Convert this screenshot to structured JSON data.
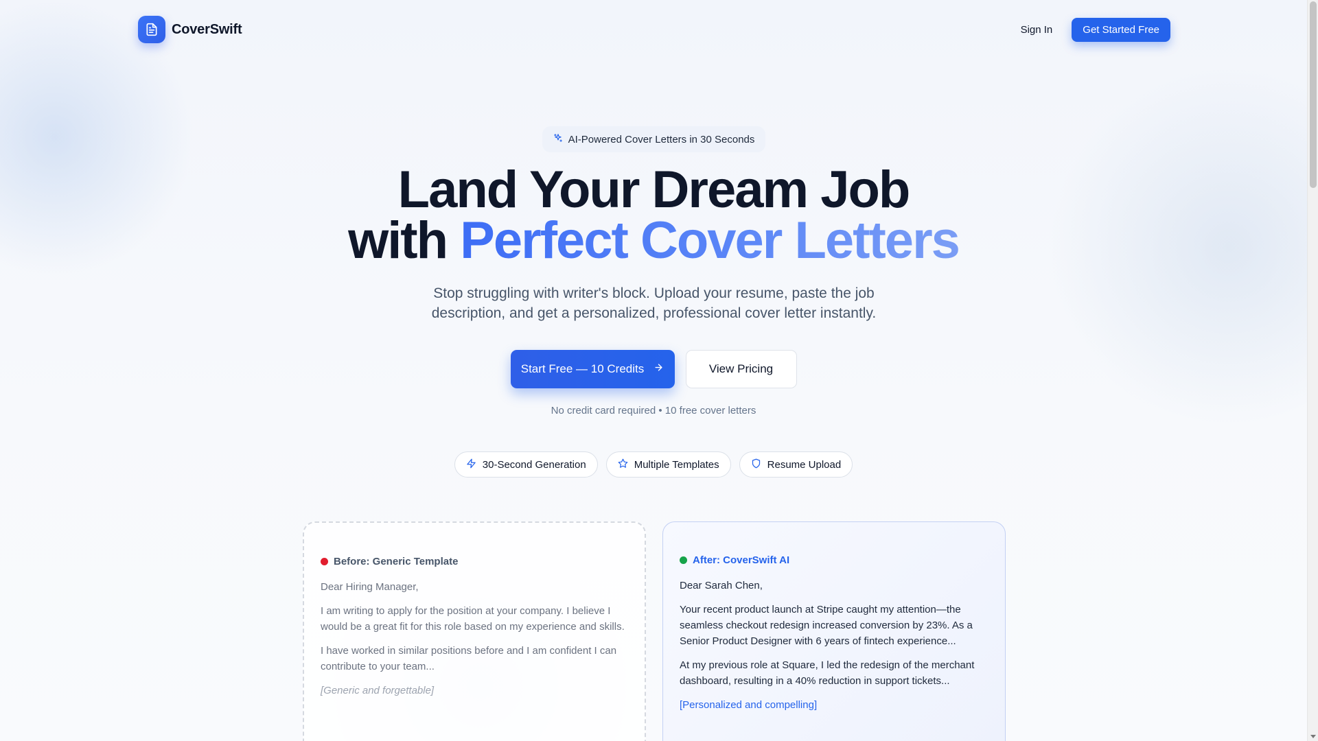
{
  "brand": {
    "name": "CoverSwift",
    "icon": "document-icon"
  },
  "nav": {
    "sign_in": "Sign In",
    "get_started": "Get Started Free"
  },
  "hero": {
    "pill": "AI-Powered Cover Letters in 30 Seconds",
    "title_line1": "Land Your Dream Job",
    "title_line2_prefix": "with ",
    "title_line2_highlight": "Perfect Cover Letters",
    "subtitle": "Stop struggling with writer's block. Upload your resume, paste the job description, and get a personalized, professional cover letter instantly.",
    "cta_primary": "Start Free — 10 Credits",
    "cta_secondary": "View Pricing",
    "note": "No credit card required • 10 free cover letters"
  },
  "features": [
    {
      "label": "30-Second Generation",
      "icon": "lightning-icon"
    },
    {
      "label": "Multiple Templates",
      "icon": "star-icon"
    },
    {
      "label": "Resume Upload",
      "icon": "shield-icon"
    }
  ],
  "before_card": {
    "label": "Before: Generic Template",
    "greeting": "Dear Hiring Manager,",
    "p1": "I am writing to apply for the position at your company. I believe I would be a great fit for this role based on my experience and skills.",
    "p2": "I have worked in similar positions before and I am confident I can contribute to your team...",
    "tag": "[Generic and forgettable]"
  },
  "after_card": {
    "label": "After: CoverSwift AI",
    "greeting": "Dear Sarah Chen,",
    "p1": "Your recent product launch at Stripe caught my attention—the seamless checkout redesign increased conversion by 23%. As a Senior Product Designer with 6 years of fintech experience...",
    "p2": "At my previous role at Square, I led the redesign of the merchant dashboard, resulting in a 40% reduction in support tickets...",
    "tag": "[Personalized and compelling]"
  },
  "colors": {
    "accent": "#2563eb",
    "before_dot": "#e11d2e",
    "after_dot": "#16a34a"
  }
}
